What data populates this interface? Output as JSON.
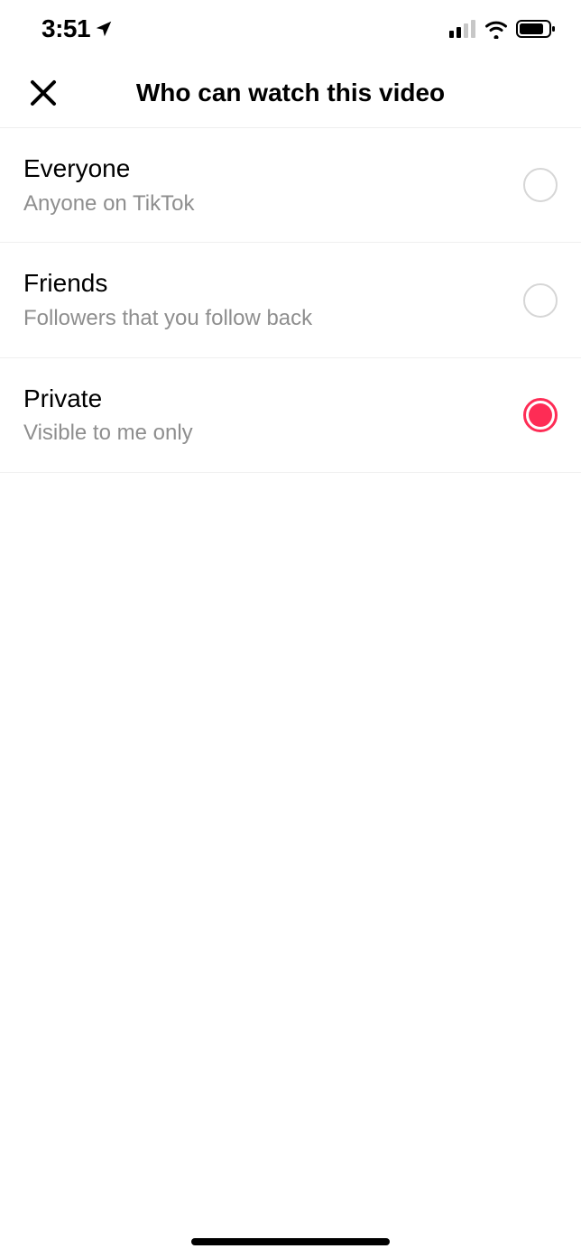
{
  "status": {
    "time": "3:51"
  },
  "header": {
    "title": "Who can watch this video"
  },
  "options": [
    {
      "title": "Everyone",
      "subtitle": "Anyone on TikTok",
      "selected": false
    },
    {
      "title": "Friends",
      "subtitle": "Followers that you follow back",
      "selected": false
    },
    {
      "title": "Private",
      "subtitle": "Visible to me only",
      "selected": true
    }
  ],
  "colors": {
    "accent": "#fe2c55",
    "text_secondary": "#8e8e8e",
    "border": "#f0f0f0"
  }
}
